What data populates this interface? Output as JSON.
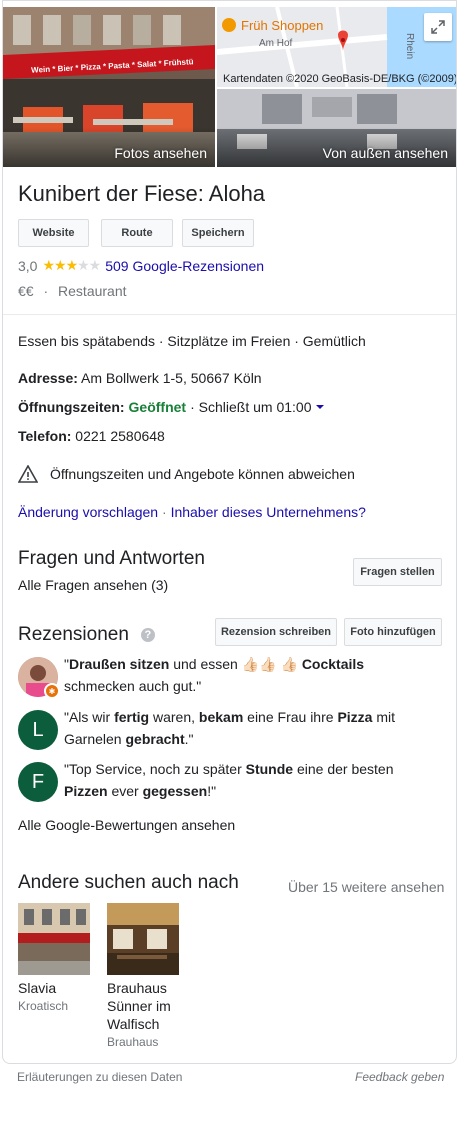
{
  "photos": {
    "photos_label": "Fotos ansehen",
    "outside_label": "Von außen ansehen",
    "map_place": "Früh Shoppen",
    "map_street": "Am Hof",
    "map_river": "Rhein",
    "map_copyright": "Kartendaten ©2020 GeoBasis-DE/BKG (©2009)",
    "awning_text": "Wein * Bier * Pizza * Pasta * Salat * Frühstü"
  },
  "place": {
    "title": "Kunibert der Fiese: Aloha",
    "buttons": {
      "website": "Website",
      "route": "Route",
      "save": "Speichern"
    },
    "rating_value": "3,0",
    "rating_stars": 3,
    "reviews_link": "509 Google-Rezensionen",
    "price": "€€",
    "sep": "·",
    "category": "Restaurant"
  },
  "details": {
    "highlights": "Essen bis spätabends · Sitzplätze im Freien · Gemütlich",
    "address_label": "Adresse:",
    "address_value": "Am Bollwerk 1-5, 50667 Köln",
    "hours_label": "Öffnungszeiten:",
    "hours_status": "Geöffnet",
    "hours_close": "· Schließt um 01:00",
    "phone_label": "Telefon:",
    "phone_value": "0221 2580648",
    "warning": "Öffnungszeiten und Angebote können abweichen",
    "suggest_link": "Änderung vorschlagen",
    "owner_link": "Inhaber dieses Unternehmens?",
    "link_sep": "·"
  },
  "qa": {
    "heading": "Fragen und Antworten",
    "all_link": "Alle Fragen ansehen (3)",
    "ask_button": "Fragen stellen"
  },
  "reviews": {
    "heading": "Rezensionen",
    "write_button": "Rezension schreiben",
    "photo_button": "Foto hinzufügen",
    "items": [
      {
        "avatar": "",
        "p1": "\"",
        "b1": "Draußen sitzen",
        "p2": " und essen 👍🏻👍🏻 👍🏻 ",
        "b2": "Cocktails",
        "p3": " schmecken auch gut.\""
      },
      {
        "avatar": "L",
        "p1": "\"Als wir ",
        "b1": "fertig",
        "p2": " waren, ",
        "b2": "bekam",
        "p3": " eine Frau ihre ",
        "b3": "Pizza",
        "p4": " mit Garnelen ",
        "b4": "gebracht",
        "p5": ".\""
      },
      {
        "avatar": "F",
        "p1": "\"Top Service, noch zu später ",
        "b1": "Stunde",
        "p2": " eine der besten ",
        "b2": "Pizzen",
        "p3": " ever ",
        "b3": "gegessen",
        "p4": "!\""
      }
    ],
    "all_link": "Alle Google-Bewertungen ansehen"
  },
  "related": {
    "heading": "Andere suchen auch nach",
    "more_link": "Über 15 weitere ansehen",
    "items": [
      {
        "name": "Slavia",
        "type": "Kroatisch"
      },
      {
        "name": "Brauhaus Sünner im Walfisch",
        "type": "Brauhaus"
      }
    ]
  },
  "footer": {
    "explain": "Erläuterungen zu diesen Daten",
    "feedback": "Feedback geben"
  },
  "colors": {
    "link": "#1a0dab",
    "open": "#188038",
    "star": "#fbbc04"
  }
}
